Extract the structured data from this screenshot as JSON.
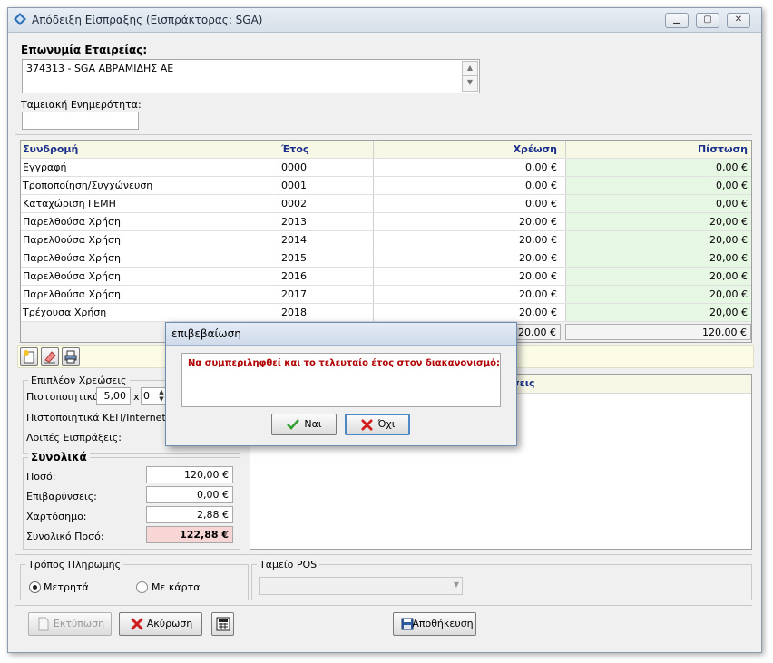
{
  "window": {
    "title": "Απόδειξη Είσπραξης (Εισπράκτορας: SGA)"
  },
  "company": {
    "label": "Επωνυμία Εταιρείας:",
    "value": "374313 - SGA ΑΒΡΑΜΙΔΗΣ ΑΕ",
    "cash_label": "Ταμειακή Ενημερότητα:",
    "cash_value": ""
  },
  "grid": {
    "headers": [
      "Συνδρομή",
      "Έτος",
      "Χρέωση",
      "Πίστωση"
    ],
    "rows": [
      {
        "name": "Εγγραφή",
        "year": "0000",
        "charge": "0,00 €",
        "credit": "0,00 €"
      },
      {
        "name": "Τροποποίηση/Συγχώνευση",
        "year": "0001",
        "charge": "0,00 €",
        "credit": "0,00 €"
      },
      {
        "name": "Καταχώριση ΓΕΜΗ",
        "year": "0002",
        "charge": "0,00 €",
        "credit": "0,00 €"
      },
      {
        "name": "Παρελθούσα Χρήση",
        "year": "2013",
        "charge": "20,00 €",
        "credit": "20,00 €"
      },
      {
        "name": "Παρελθούσα Χρήση",
        "year": "2014",
        "charge": "20,00 €",
        "credit": "20,00 €"
      },
      {
        "name": "Παρελθούσα Χρήση",
        "year": "2015",
        "charge": "20,00 €",
        "credit": "20,00 €"
      },
      {
        "name": "Παρελθούσα Χρήση",
        "year": "2016",
        "charge": "20,00 €",
        "credit": "20,00 €"
      },
      {
        "name": "Παρελθούσα Χρήση",
        "year": "2017",
        "charge": "20,00 €",
        "credit": "20,00 €"
      },
      {
        "name": "Τρέχουσα Χρήση",
        "year": "2018",
        "charge": "20,00 €",
        "credit": "20,00 €"
      }
    ],
    "total_charge": "120,00 €",
    "total_credit": "120,00 €"
  },
  "extra_charges": {
    "title": "Επιπλέον Χρεώσεις",
    "certificates_label": "Πιστοποιητικά:",
    "certificates_price": "5,00",
    "times": "x",
    "certificates_qty": "0",
    "kep_label": "Πιστοποιητικά ΚΕΠ/Internet:",
    "other_label": "Λοιπές Εισπράξεις:"
  },
  "notes_header_fragment": "σεις",
  "totals": {
    "title": "Συνολικά",
    "amount_label": "Ποσό:",
    "amount": "120,00 €",
    "surcharges_label": "Επιβαρύνσεις:",
    "surcharges": "0,00 €",
    "stamp_label": "Χαρτόσημο:",
    "stamp": "2,88 €",
    "total_label": "Συνολικό Ποσό:",
    "total": "122,88 €"
  },
  "payment": {
    "title": "Τρόπος Πληρωμής",
    "cash": "Μετρητά",
    "card": "Με κάρτα",
    "pos_title": "Ταμείο POS",
    "pos_value": ""
  },
  "buttons": {
    "print": "Εκτύπωση",
    "cancel": "Ακύρωση",
    "save": "Αποθήκευση"
  },
  "dialog": {
    "title": "επιβεβαίωση",
    "message": "Να συμπεριληφθεί και το τελευταίο έτος στον διακανονισμό;",
    "yes": "Ναι",
    "no": "Όχι"
  },
  "colors": {
    "credit_bg": "#e6f7e3",
    "total_bg": "#f9d6d6",
    "header_text": "#1a2f8a",
    "dialog_message": "#b00000"
  }
}
